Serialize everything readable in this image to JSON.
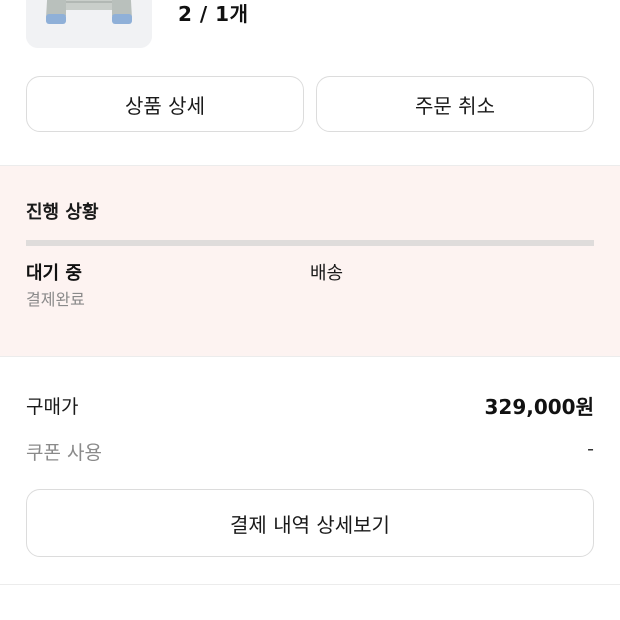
{
  "product": {
    "quantity_text": "2 / 1개"
  },
  "actions": {
    "detail_label": "상품 상세",
    "cancel_label": "주문 취소"
  },
  "progress": {
    "title": "진행 상황",
    "current_step": "대기 중",
    "current_status": "결제완료",
    "next_step": "배송"
  },
  "payment": {
    "price_label": "구매가",
    "price_value": "329,000원",
    "coupon_label": "쿠폰 사용",
    "coupon_value": "-",
    "details_button": "결제 내역 상세보기"
  },
  "colors": {
    "panel_background": "#fdf3f1",
    "border": "#dcdcdc"
  },
  "icons": {
    "product_image": "puffer-jacket-image"
  }
}
